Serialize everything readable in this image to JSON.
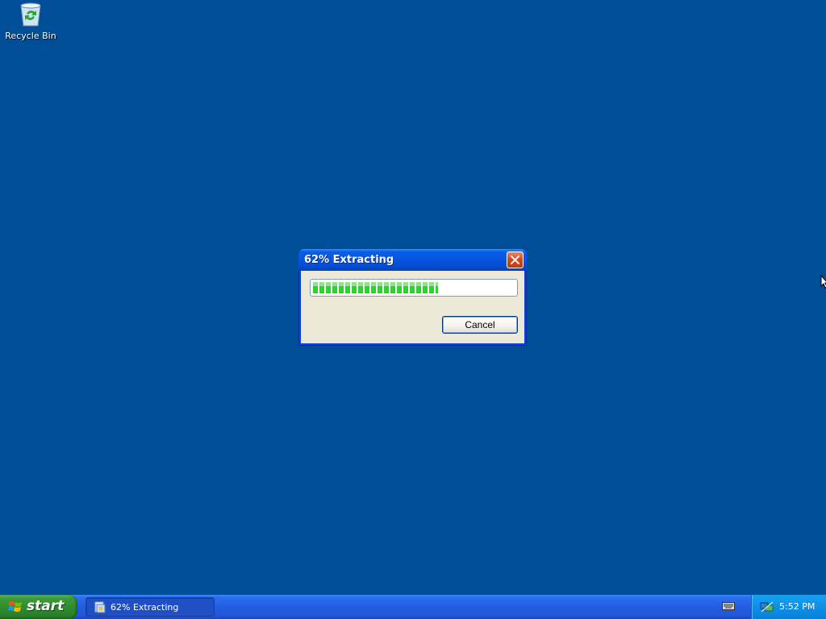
{
  "desktop": {
    "icons": [
      {
        "label": "Recycle Bin",
        "icon": "recycle-bin-icon"
      }
    ]
  },
  "dialog": {
    "title": "62% Extracting",
    "progress_percent": 62,
    "cancel_label": "Cancel",
    "close_icon": "close-icon"
  },
  "taskbar": {
    "start_label": "start",
    "tasks": [
      {
        "label": "62% Extracting",
        "icon": "extract-icon"
      }
    ],
    "tray": {
      "icons": [
        "keyboard-icon",
        "network-icon"
      ],
      "clock": "5:52 PM"
    }
  },
  "colors": {
    "desktop_bg": "#004e98",
    "progress_fill": "#2fd12f",
    "titlebar": "#0656e0"
  }
}
